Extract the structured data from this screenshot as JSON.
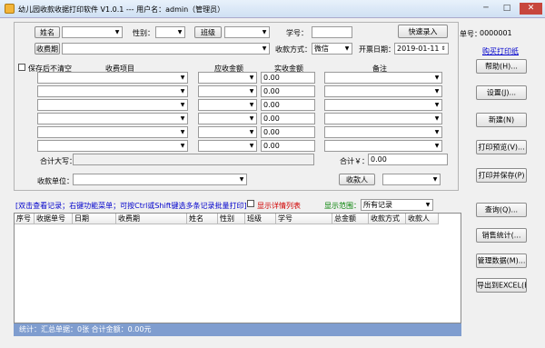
{
  "window": {
    "title": "幼儿园收款收据打印软件 V1.0.1 --- 用户名：admin（管理员）",
    "min": "─",
    "max": "□",
    "close": "✕"
  },
  "form": {
    "name_btn": "姓名",
    "gender_label": "性别：",
    "class_btn": "班级",
    "student_no_label": "学号：",
    "quick_btn": "快速录入",
    "fee_period_btn": "收费期",
    "pay_method_label": "收款方式：",
    "pay_method_value": "微信",
    "invoice_date_label": "开票日期：",
    "invoice_date_value": "2019-01-11",
    "keep_checkbox_label": "保存后不清空",
    "col_item": "收费项目",
    "col_due": "应收金额",
    "col_actual": "实收金额",
    "col_note": "备注",
    "actual_values": [
      "0.00",
      "0.00",
      "0.00",
      "0.00",
      "0.00",
      "0.00"
    ],
    "total_upper_label": "合计大写：",
    "total_yen_label": "合计￥：",
    "total_value": "0.00",
    "payer_label": "收款单位：",
    "receiver_btn": "收款人"
  },
  "right_panel": {
    "receipt_no_label": "单号：",
    "receipt_no_value": "0000001",
    "buy_paper_link": "购买打印纸",
    "help_btn": "帮助(H)...",
    "settings_btn": "设置(J)...",
    "new_btn": "新建(N)",
    "preview_btn": "打印预览(V)...",
    "print_save_btn": "打印并保存(P)"
  },
  "list": {
    "hint": "[双击查看记录；右键功能菜单；可按Ctrl或Shift键选多条记录批量打印]",
    "detail_checkbox_label": "显示详情列表",
    "range_label": "显示范围：",
    "range_value": "所有记录",
    "columns": [
      "序号",
      "收据单号",
      "日期",
      "收费期",
      "姓名",
      "性别",
      "班级",
      "学号",
      "总金额",
      "收款方式",
      "收款人"
    ]
  },
  "list_buttons": {
    "query": "查询(Q)...",
    "sales_stats": "销售统计(...",
    "data_mgmt": "管理数据(M)...",
    "export_excel": "导出到EXCEL(E)"
  },
  "status": {
    "text": "统计：汇总单据：0张 合计金额：0.00元"
  }
}
